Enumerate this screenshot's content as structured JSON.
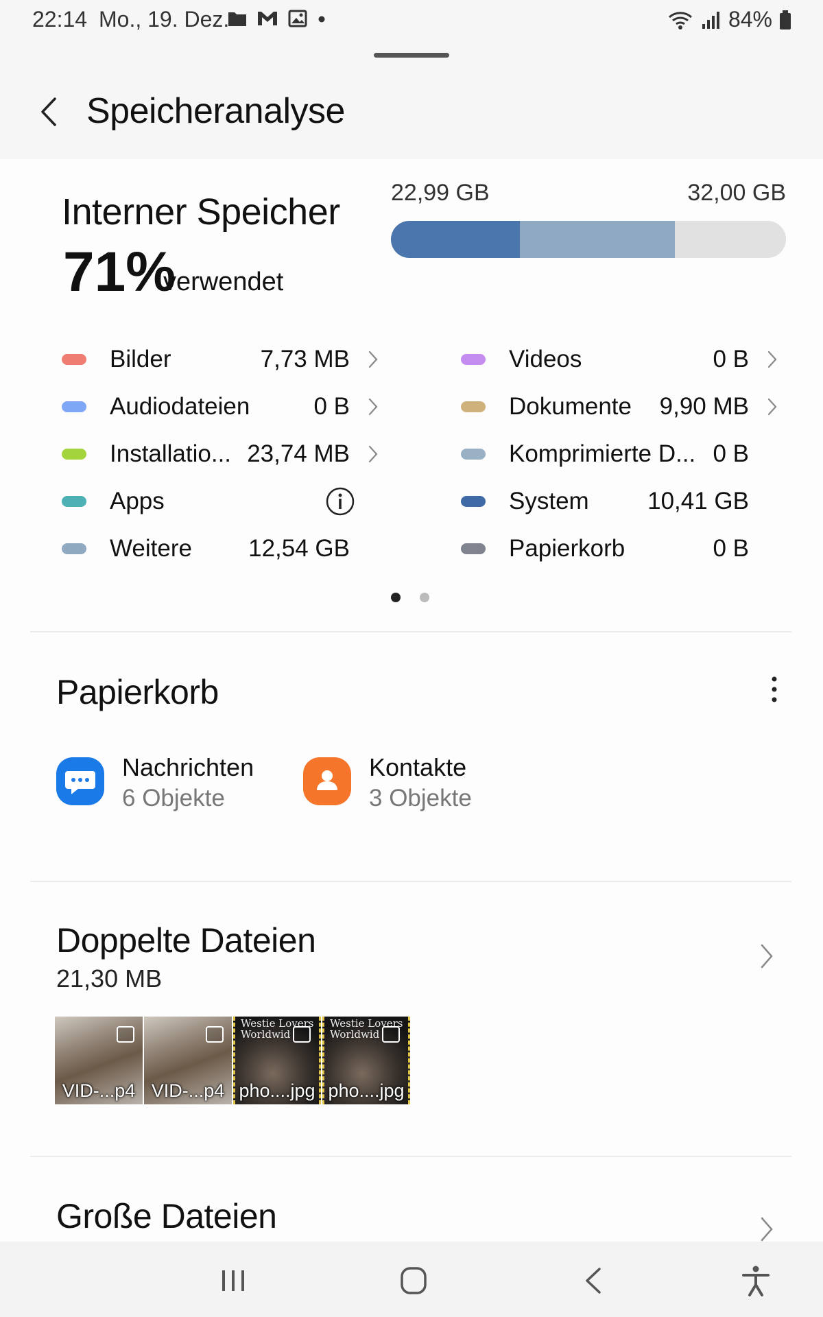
{
  "status_bar": {
    "time": "22:14",
    "date": "Mo., 19. Dez.",
    "battery": "84%"
  },
  "header": {
    "title": "Speicheranalyse"
  },
  "storage": {
    "title": "Interner Speicher",
    "percent": "71%",
    "used_label": "verwendet",
    "used": "22,99 GB",
    "total": "32,00 GB",
    "bar_fractions": [
      0.327,
      0.392
    ],
    "bar_colors": [
      "#4a76ad",
      "#8fa9c2"
    ],
    "categories_left": [
      {
        "label": "Bilder",
        "value": "7,73 MB",
        "color": "#ef7d72",
        "action": "chevron"
      },
      {
        "label": "Audiodateien",
        "value": "0 B",
        "color": "#7ea7f5",
        "action": "chevron"
      },
      {
        "label": "Installatio...",
        "value": "23,74 MB",
        "color": "#a4d43c",
        "action": "chevron"
      },
      {
        "label": "Apps",
        "value": "",
        "color": "#4cb0b4",
        "action": "info"
      },
      {
        "label": "Weitere",
        "value": "12,54 GB",
        "color": "#8fa9c0",
        "action": "none"
      }
    ],
    "categories_right": [
      {
        "label": "Videos",
        "value": "0 B",
        "color": "#c58cf0",
        "action": "chevron"
      },
      {
        "label": "Dokumente",
        "value": "9,90 MB",
        "color": "#cfb27b",
        "action": "chevron"
      },
      {
        "label": "Komprimierte D...",
        "value": "0 B",
        "color": "#9ab0c4",
        "action": "none"
      },
      {
        "label": "System",
        "value": "10,41 GB",
        "color": "#3f6aa6",
        "action": "none"
      },
      {
        "label": "Papierkorb",
        "value": "0 B",
        "color": "#80848e",
        "action": "none"
      }
    ]
  },
  "trash": {
    "title": "Papierkorb",
    "items": [
      {
        "name": "Nachrichten",
        "count": "6 Objekte",
        "icon": "messages-icon"
      },
      {
        "name": "Kontakte",
        "count": "3 Objekte",
        "icon": "contacts-icon"
      }
    ]
  },
  "duplicates": {
    "title": "Doppelte Dateien",
    "size": "21,30 MB",
    "thumbnails": [
      {
        "caption": "VID-...p4",
        "overlay": ""
      },
      {
        "caption": "VID-...p4",
        "overlay": ""
      },
      {
        "caption": "pho....jpg",
        "overlay": "Westie Lovers Worldwid"
      },
      {
        "caption": "pho....jpg",
        "overlay": "Westie Lovers Worldwid"
      }
    ]
  },
  "large_files": {
    "title": "Große Dateien"
  },
  "navigation": {
    "buttons": [
      "recent-apps-icon",
      "home-icon",
      "back-icon",
      "accessibility-icon"
    ]
  }
}
